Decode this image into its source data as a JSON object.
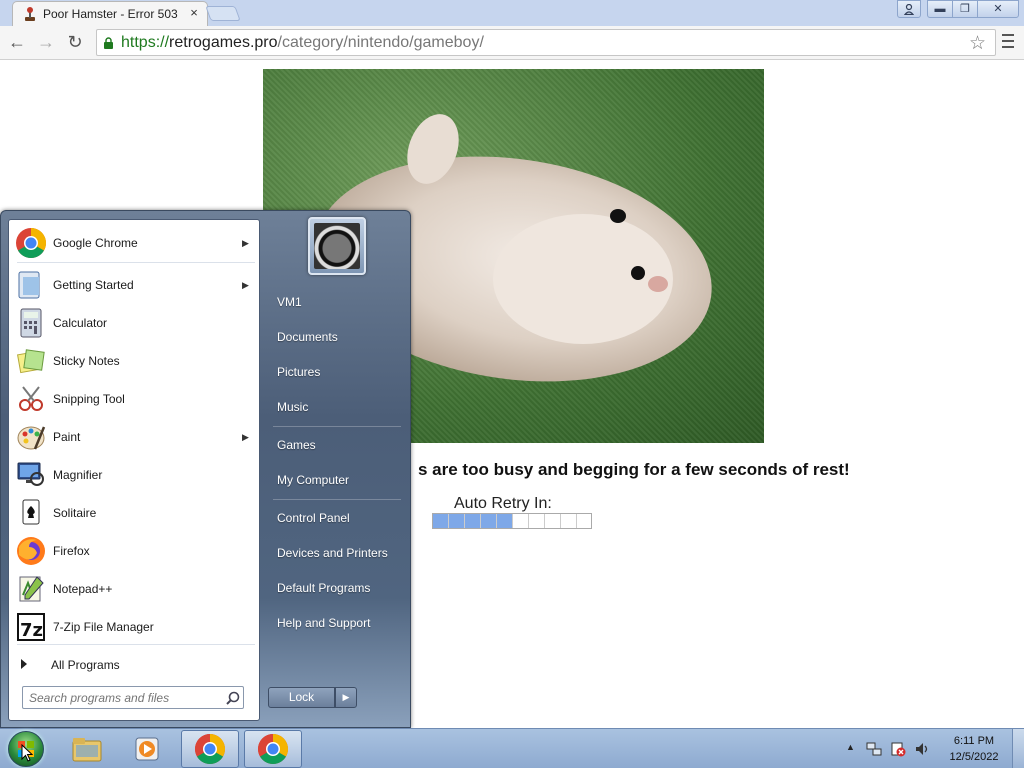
{
  "browser": {
    "tab_title": "Poor Hamster - Error 503",
    "tab_close": "×",
    "url_scheme": "https://",
    "url_host": "retrogames.pro",
    "url_path": "/category/nintendo/gameboy/",
    "star": "☆",
    "back": "←",
    "forward": "→",
    "reload": "↻"
  },
  "window": {
    "minimize": "▬",
    "restore": "❐",
    "close": "✕"
  },
  "page": {
    "error_message": "s are too busy and begging for a few seconds of rest!",
    "retry_label": "Auto Retry In:",
    "retry_progress": 0.5
  },
  "start_menu": {
    "programs": [
      {
        "label": "Google Chrome",
        "icon": "chrome-icon",
        "arrow": "▶"
      },
      {
        "label": "Getting Started",
        "icon": "getting-started-icon",
        "arrow": "▶"
      },
      {
        "label": "Calculator",
        "icon": "calculator-icon",
        "arrow": ""
      },
      {
        "label": "Sticky Notes",
        "icon": "sticky-notes-icon",
        "arrow": ""
      },
      {
        "label": "Snipping Tool",
        "icon": "snipping-tool-icon",
        "arrow": ""
      },
      {
        "label": "Paint",
        "icon": "paint-icon",
        "arrow": "▶"
      },
      {
        "label": "Magnifier",
        "icon": "magnifier-icon",
        "arrow": ""
      },
      {
        "label": "Solitaire",
        "icon": "solitaire-icon",
        "arrow": ""
      },
      {
        "label": "Firefox",
        "icon": "firefox-icon",
        "arrow": ""
      },
      {
        "label": "Notepad++",
        "icon": "notepadpp-icon",
        "arrow": ""
      },
      {
        "label": "7-Zip File Manager",
        "icon": "seven-zip-icon",
        "arrow": ""
      }
    ],
    "all_programs": "All Programs",
    "search_placeholder": "Search programs and files",
    "right_items": [
      {
        "label": "VM1"
      },
      {
        "label": "Documents"
      },
      {
        "label": "Pictures"
      },
      {
        "label": "Music"
      },
      {
        "label": "Games"
      },
      {
        "label": "My Computer"
      },
      {
        "label": "Control Panel"
      },
      {
        "label": "Devices and Printers"
      },
      {
        "label": "Default Programs"
      },
      {
        "label": "Help and Support"
      }
    ],
    "lock_label": "Lock",
    "lock_arrow": "▶"
  },
  "taskbar": {
    "time": "6:11 PM",
    "date": "12/5/2022",
    "tray_arrow": "▲"
  },
  "colors": {
    "accent_progress": "#7ea8e8",
    "url_scheme": "#1f7a1f"
  }
}
